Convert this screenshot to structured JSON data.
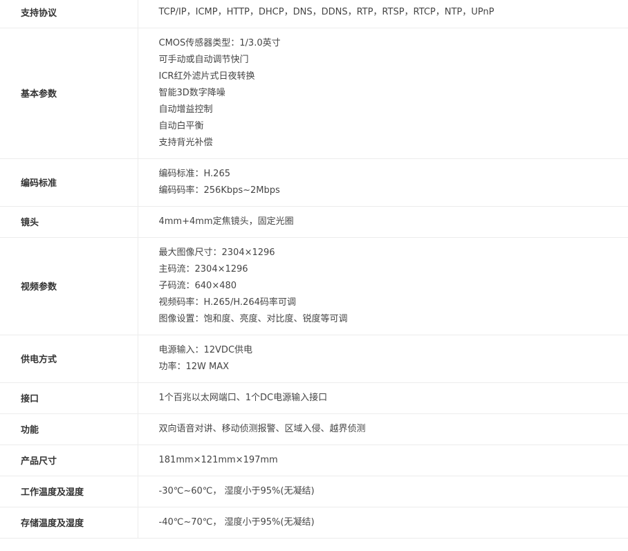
{
  "specs": [
    {
      "key": "支持协议",
      "lines": [
        "TCP/IP，ICMP，HTTP，DHCP，DNS，DDNS，RTP，RTSP，RTCP，NTP，UPnP"
      ]
    },
    {
      "key": "基本参数",
      "lines": [
        "CMOS传感器类型：1/3.0英寸",
        "可手动或自动调节快门",
        "ICR红外滤片式日夜转换",
        "智能3D数字降噪",
        "自动增益控制",
        "自动白平衡",
        "支持背光补偿"
      ]
    },
    {
      "key": "编码标准",
      "lines": [
        "编码标准：H.265",
        "编码码率：256Kbps~2Mbps"
      ]
    },
    {
      "key": "镜头",
      "lines": [
        "4mm+4mm定焦镜头，固定光圈"
      ]
    },
    {
      "key": "视频参数",
      "lines": [
        "最大图像尺寸：2304×1296",
        "主码流：2304×1296",
        "子码流：640×480",
        "视频码率：H.265/H.264码率可调",
        "图像设置：饱和度、亮度、对比度、锐度等可调"
      ]
    },
    {
      "key": "供电方式",
      "lines": [
        "电源输入：12VDC供电",
        "功率：12W MAX"
      ]
    },
    {
      "key": "接口",
      "lines": [
        "1个百兆以太网端口、1个DC电源输入接口"
      ]
    },
    {
      "key": "功能",
      "lines": [
        "双向语音对讲、移动侦测报警、区域入侵、越界侦测"
      ]
    },
    {
      "key": "产品尺寸",
      "lines": [
        "181mm×121mm×197mm"
      ]
    },
    {
      "key": "工作温度及湿度",
      "lines": [
        "-30℃~60℃， 湿度小于95%(无凝结)"
      ]
    },
    {
      "key": "存储温度及湿度",
      "lines": [
        "-40℃~70℃， 湿度小于95%(无凝结)"
      ]
    }
  ]
}
